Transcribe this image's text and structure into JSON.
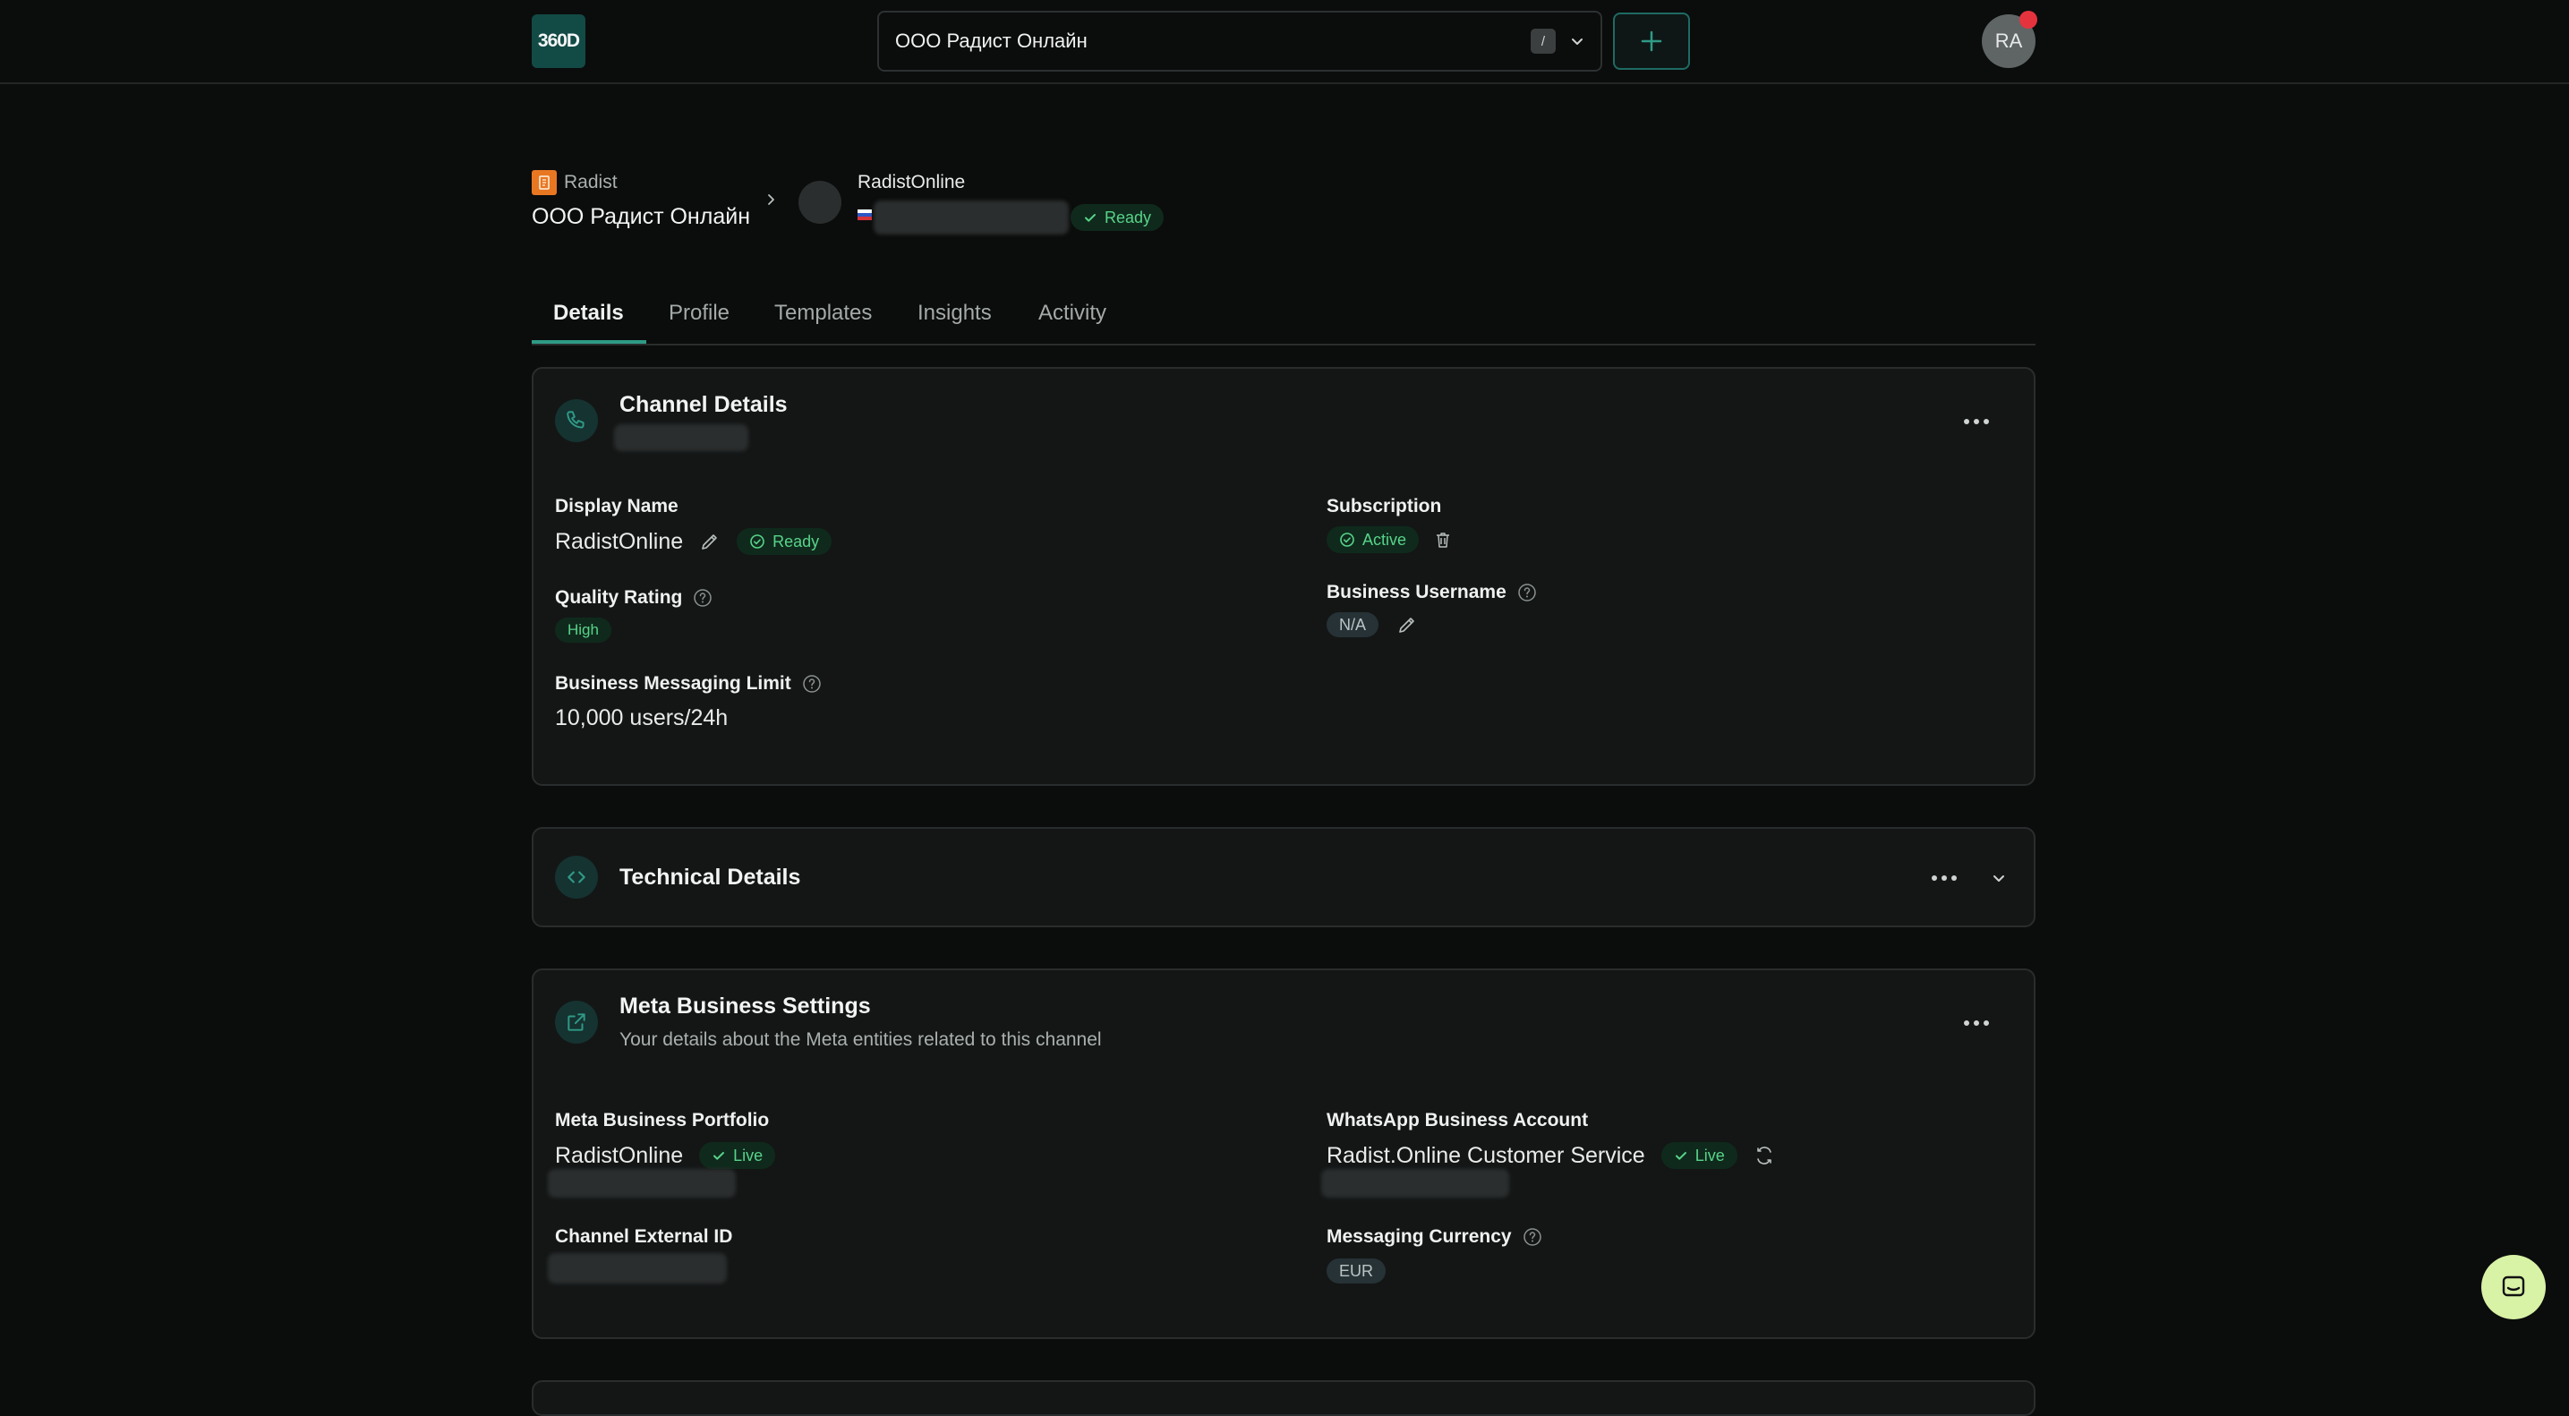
{
  "topbar": {
    "logo_text": "360D",
    "org_selector": {
      "value": "ООО Радист Онлайн",
      "shortcut": "/"
    },
    "avatar_initials": "RA"
  },
  "header": {
    "partner_name": "Radist",
    "client_name": "ООО Радист Онлайн",
    "channel_name": "RadistOnline",
    "channel_status": "Ready"
  },
  "tabs": [
    "Details",
    "Profile",
    "Templates",
    "Insights",
    "Activity"
  ],
  "channel_details": {
    "title": "Channel Details",
    "display_name": {
      "label": "Display Name",
      "value": "RadistOnline",
      "status": "Ready"
    },
    "quality_rating": {
      "label": "Quality Rating",
      "value": "High"
    },
    "messaging_limit": {
      "label": "Business Messaging Limit",
      "value": "10,000 users/24h"
    },
    "subscription": {
      "label": "Subscription",
      "status": "Active"
    },
    "business_username": {
      "label": "Business Username",
      "value": "N/A"
    }
  },
  "technical_details": {
    "title": "Technical Details"
  },
  "meta_settings": {
    "title": "Meta Business Settings",
    "subtitle": "Your details about the Meta entities related to this channel",
    "portfolio": {
      "label": "Meta Business Portfolio",
      "value": "RadistOnline",
      "status": "Live"
    },
    "waba": {
      "label": "WhatsApp Business Account",
      "value": "Radist.Online Customer Service",
      "status": "Live"
    },
    "external_id": {
      "label": "Channel External ID"
    },
    "currency": {
      "label": "Messaging Currency",
      "value": "EUR"
    }
  },
  "colors": {
    "background": "#0b0c0c",
    "card": "#141616",
    "accent": "#2f9a86",
    "success": "#58d38a",
    "notification": "#e5333e",
    "chat_button": "#d8f2a6"
  }
}
